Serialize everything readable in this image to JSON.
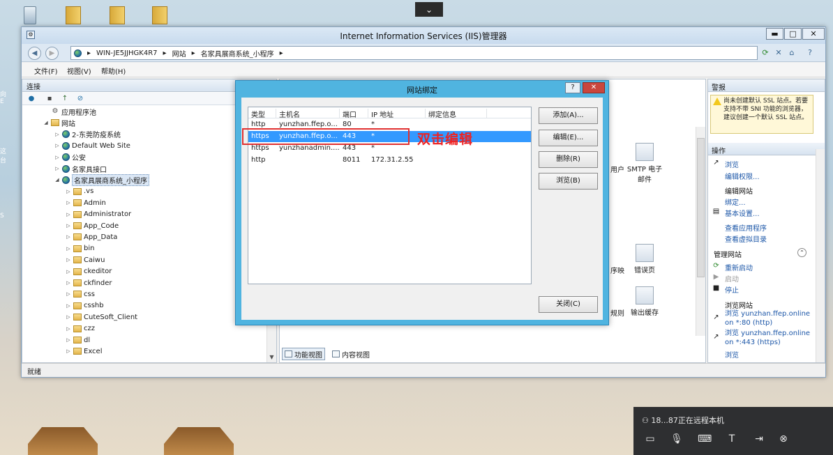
{
  "desktop": {
    "left_edge_labels": [
      "向E",
      "这台",
      "S"
    ]
  },
  "window": {
    "title": "Internet Information Services (IIS)管理器",
    "controls": {
      "minimize": "▬",
      "maximize": "□",
      "close": "✕"
    }
  },
  "address": {
    "crumbs": [
      "WIN-JE5JJHGK4R7",
      "网站",
      "名家具展商系统_小程序"
    ],
    "separator": "▸"
  },
  "menu": [
    "文件(F)",
    "视图(V)",
    "帮助(H)"
  ],
  "connections": {
    "title": "连接",
    "tree": [
      {
        "label": "应用程序池",
        "indent": 0,
        "icon": "gear",
        "twisty": ""
      },
      {
        "label": "网站",
        "indent": 0,
        "icon": "folder",
        "twisty": "◢"
      },
      {
        "label": "2-东莞防疫系统",
        "indent": 1,
        "icon": "globe",
        "twisty": "▷"
      },
      {
        "label": "Default Web Site",
        "indent": 1,
        "icon": "globe",
        "twisty": "▷"
      },
      {
        "label": "公安",
        "indent": 1,
        "icon": "globe",
        "twisty": "▷"
      },
      {
        "label": "名家具接口",
        "indent": 1,
        "icon": "globe",
        "twisty": "▷"
      },
      {
        "label": "名家具展商系统_小程序",
        "indent": 1,
        "icon": "globe",
        "twisty": "◢",
        "selected": true
      },
      {
        "label": ".vs",
        "indent": 2,
        "icon": "folder",
        "twisty": "▷"
      },
      {
        "label": "Admin",
        "indent": 2,
        "icon": "folder",
        "twisty": "▷"
      },
      {
        "label": "Administrator",
        "indent": 2,
        "icon": "folder",
        "twisty": "▷"
      },
      {
        "label": "App_Code",
        "indent": 2,
        "icon": "folder",
        "twisty": "▷"
      },
      {
        "label": "App_Data",
        "indent": 2,
        "icon": "folder",
        "twisty": "▷"
      },
      {
        "label": "bin",
        "indent": 2,
        "icon": "folder",
        "twisty": "▷"
      },
      {
        "label": "Caiwu",
        "indent": 2,
        "icon": "folder",
        "twisty": "▷"
      },
      {
        "label": "ckeditor",
        "indent": 2,
        "icon": "folder",
        "twisty": "▷"
      },
      {
        "label": "ckfinder",
        "indent": 2,
        "icon": "folder",
        "twisty": "▷"
      },
      {
        "label": "css",
        "indent": 2,
        "icon": "folder",
        "twisty": "▷"
      },
      {
        "label": "csshb",
        "indent": 2,
        "icon": "folder",
        "twisty": "▷"
      },
      {
        "label": "CuteSoft_Client",
        "indent": 2,
        "icon": "folder",
        "twisty": "▷"
      },
      {
        "label": "czz",
        "indent": 2,
        "icon": "folder",
        "twisty": "▷"
      },
      {
        "label": "dl",
        "indent": 2,
        "icon": "folder",
        "twisty": "▷"
      },
      {
        "label": "Excel",
        "indent": 2,
        "icon": "folder",
        "twisty": "▷"
      }
    ]
  },
  "center": {
    "features": [
      {
        "label": "SMTP 电子\n邮件",
        "name": "smtp-email-feature"
      },
      {
        "label": "错误页",
        "name": "error-pages-feature"
      },
      {
        "label": "输出缓存",
        "name": "output-cache-feature"
      }
    ],
    "partial_labels": [
      "用户",
      "序映",
      "规则"
    ],
    "view_tabs": [
      "功能视图",
      "内容视图"
    ]
  },
  "actions": {
    "alerts_title": "警报",
    "alert_text": "尚未创建默认 SSL 站点。若要支持不带 SNI 功能的浏览器，建议创建一个默认 SSL 站点。",
    "ops_title": "操作",
    "browse": "浏览",
    "edit_perms": "编辑权限...",
    "edit_site": "编辑网站",
    "bindings": "绑定...",
    "basic_settings": "基本设置...",
    "view_apps": "查看应用程序",
    "view_vdirs": "查看虚拟目录",
    "manage_site": "管理网站",
    "restart": "重新启动",
    "start": "启动",
    "stop": "停止",
    "browse_site": "浏览网站",
    "browse_http": "浏览 yunzhan.ffep.online on *:80 (http)",
    "browse_https": "浏览 yunzhan.ffep.online on *:443 (https)",
    "browse_more": "浏览"
  },
  "status": "就绪",
  "dialog": {
    "title": "网站绑定",
    "help": "?",
    "close": "✕",
    "columns": [
      "类型",
      "主机名",
      "端口",
      "IP 地址",
      "绑定信息"
    ],
    "rows": [
      {
        "type": "http",
        "host": "yunzhan.ffep.o...",
        "port": "80",
        "ip": "*",
        "info": ""
      },
      {
        "type": "https",
        "host": "yunzhan.ffep.o...",
        "port": "443",
        "ip": "*",
        "info": "",
        "selected": true
      },
      {
        "type": "https",
        "host": "yunzhanadmin....",
        "port": "443",
        "ip": "*",
        "info": ""
      },
      {
        "type": "http",
        "host": "",
        "port": "8011",
        "ip": "172.31.2.55",
        "info": ""
      }
    ],
    "buttons": {
      "add": "添加(A)...",
      "edit": "编辑(E)...",
      "remove": "删除(R)",
      "browse": "浏览(B)",
      "close": "关闭(C)"
    }
  },
  "annotation": {
    "text": "双击编辑",
    "color": "#ee2222"
  },
  "remote": {
    "status": "18...87正在远程本机"
  }
}
